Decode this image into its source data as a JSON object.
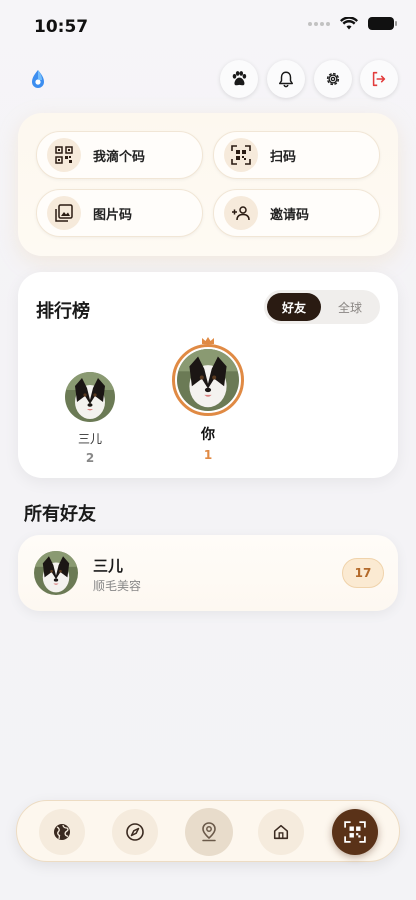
{
  "status": {
    "time": "10:57"
  },
  "quick_actions": [
    {
      "label": "我滴个码",
      "icon": "qr-code-icon"
    },
    {
      "label": "扫码",
      "icon": "scan-icon"
    },
    {
      "label": "图片码",
      "icon": "image-icon"
    },
    {
      "label": "邀请码",
      "icon": "add-user-icon"
    }
  ],
  "leaderboard": {
    "title": "排行榜",
    "tabs": {
      "friends": "好友",
      "global": "全球"
    },
    "second": {
      "name": "三儿",
      "rank": "2"
    },
    "first": {
      "name": "你",
      "rank": "1"
    }
  },
  "friends": {
    "title": "所有好友",
    "items": [
      {
        "name": "三儿",
        "subtitle": "顺毛美容",
        "count": "17"
      }
    ]
  },
  "colors": {
    "accent": "#e08a44",
    "dark": "#2a1b12",
    "card_bg": "#fdf8ef"
  }
}
